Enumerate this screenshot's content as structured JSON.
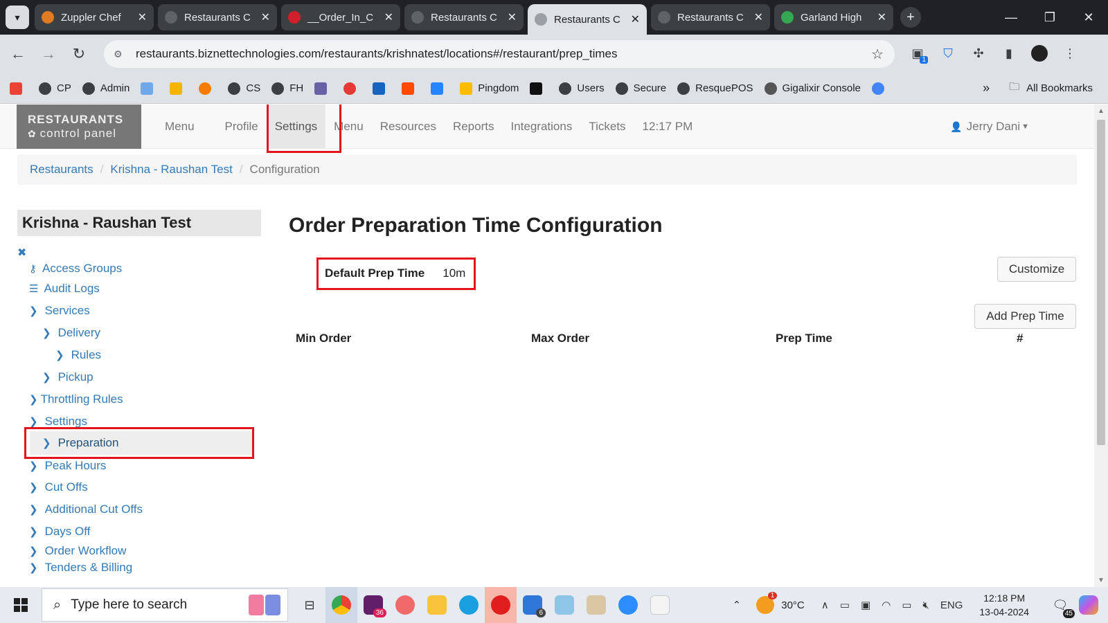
{
  "browser": {
    "tabs": [
      {
        "title": "Zuppler Chef",
        "active": false,
        "icon": "zuppler-chef-icon"
      },
      {
        "title": "Restaurants C",
        "active": false,
        "icon": "globe-icon"
      },
      {
        "title": "__Order_In_C",
        "active": false,
        "icon": "opera-icon"
      },
      {
        "title": "Restaurants C",
        "active": false,
        "icon": "globe-icon"
      },
      {
        "title": "Restaurants C",
        "active": true,
        "icon": "globe-icon"
      },
      {
        "title": "Restaurants C",
        "active": false,
        "icon": "globe-icon"
      },
      {
        "title": "Garland High",
        "active": false,
        "icon": "maps-pin-icon"
      }
    ],
    "url": "restaurants.biznettechnologies.com/restaurants/krishnatest/locations#/restaurant/prep_times",
    "extension_badge": "1",
    "bookmarks": [
      {
        "label": "",
        "icon": "gmail-icon"
      },
      {
        "label": "CP",
        "icon": "globe-icon"
      },
      {
        "label": "Admin",
        "icon": "globe-icon"
      },
      {
        "label": "",
        "icon": "pos-icon"
      },
      {
        "label": "",
        "icon": "colorful-icon"
      },
      {
        "label": "",
        "icon": "orange-icon"
      },
      {
        "label": "CS",
        "icon": "globe-icon"
      },
      {
        "label": "FH",
        "icon": "globe-icon"
      },
      {
        "label": "",
        "icon": "heroku-icon"
      },
      {
        "label": "",
        "icon": "lifebuoy-icon"
      },
      {
        "label": "",
        "icon": "blue-b-icon"
      },
      {
        "label": "",
        "icon": "zapier-icon"
      },
      {
        "label": "",
        "icon": "confluence-icon"
      },
      {
        "label": "Pingdom",
        "icon": "pingdom-icon"
      },
      {
        "label": "",
        "icon": "pp-icon"
      },
      {
        "label": "Users",
        "icon": "globe-icon"
      },
      {
        "label": "Secure",
        "icon": "globe-icon"
      },
      {
        "label": "ResquePOS",
        "icon": "globe-icon"
      },
      {
        "label": "Gigalixir Console",
        "icon": "google-icon"
      },
      {
        "label": "",
        "icon": "assistant-icon"
      }
    ],
    "all_bookmarks": "All Bookmarks"
  },
  "app": {
    "brand_line1": "RESTAURANTS",
    "brand_line2": "control panel",
    "nav": [
      "Menu",
      "Profile",
      "Settings",
      "Menu",
      "Resources",
      "Reports",
      "Integrations",
      "Tickets"
    ],
    "active_nav": "Settings",
    "time": "12:17 PM",
    "user": "Jerry Dani"
  },
  "breadcrumb": {
    "items": [
      "Restaurants",
      "Krishna - Raushan Test"
    ],
    "current": "Configuration"
  },
  "sidebar": {
    "title": "Krishna - Raushan Test",
    "items": [
      {
        "label": "Access Groups",
        "icon": "key-icon",
        "level": 0
      },
      {
        "label": "Audit Logs",
        "icon": "list-icon",
        "level": 0
      },
      {
        "label": "Services",
        "icon": "chevron-right-icon",
        "level": 0
      },
      {
        "label": "Delivery",
        "icon": "chevron-right-icon",
        "level": 1
      },
      {
        "label": "Rules",
        "icon": "chevron-right-icon",
        "level": 2
      },
      {
        "label": "Pickup",
        "icon": "chevron-right-icon",
        "level": 1
      },
      {
        "label": "Throttling Rules",
        "icon": "chevron-right-icon",
        "level": 0
      },
      {
        "label": "Settings",
        "icon": "chevron-right-icon",
        "level": 0
      },
      {
        "label": "Preparation",
        "icon": "chevron-right-icon",
        "level": 1,
        "active": true
      },
      {
        "label": "Peak Hours",
        "icon": "chevron-right-icon",
        "level": 0
      },
      {
        "label": "Cut Offs",
        "icon": "chevron-right-icon",
        "level": 0
      },
      {
        "label": "Additional Cut Offs",
        "icon": "chevron-right-icon",
        "level": 0
      },
      {
        "label": "Days Off",
        "icon": "chevron-right-icon",
        "level": 0
      },
      {
        "label": "Order Workflow",
        "icon": "chevron-right-icon",
        "level": 0
      },
      {
        "label": "Tenders & Billing",
        "icon": "chevron-right-icon",
        "level": 0
      }
    ]
  },
  "main": {
    "title": "Order Preparation Time Configuration",
    "default_prep_label": "Default Prep Time",
    "default_prep_value": "10m",
    "customize_button": "Customize",
    "add_button": "Add Prep Time",
    "columns": [
      "Min Order",
      "Max Order",
      "Prep Time",
      "#"
    ]
  },
  "taskbar": {
    "search_placeholder": "Type here to search",
    "slack_badge": "36",
    "todo_badge": "6",
    "weather_badge": "1",
    "temperature": "30°C",
    "language": "ENG",
    "time": "12:18 PM",
    "date": "13-04-2024",
    "notification_count": "45"
  },
  "colors": {
    "link": "#337ab7",
    "highlight_border": "#e3141b",
    "navbar_bg": "#f8f8f8",
    "brand_bg": "#777777"
  }
}
